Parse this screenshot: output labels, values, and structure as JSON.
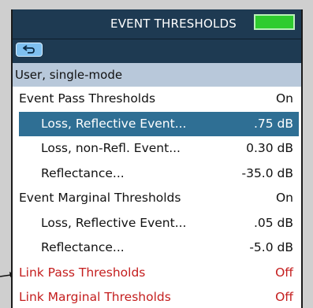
{
  "header": {
    "title": "EVENT THRESHOLDS"
  },
  "toolbar": {
    "back_icon": "back-arrow-icon"
  },
  "section": {
    "label": "User, single-mode"
  },
  "rows": [
    {
      "label": "Event Pass Thresholds",
      "value": "On"
    },
    {
      "label": "Loss, Reflective Event...",
      "value": ".75 dB"
    },
    {
      "label": "Loss, non-Refl. Event...",
      "value": "0.30 dB"
    },
    {
      "label": "Reflectance...",
      "value": "-35.0 dB"
    },
    {
      "label": "Event Marginal Thresholds",
      "value": "On"
    },
    {
      "label": "Loss, Reflective Event...",
      "value": ".05 dB"
    },
    {
      "label": "Reflectance...",
      "value": "-5.0 dB"
    },
    {
      "label": "Link Pass Thresholds",
      "value": "Off"
    },
    {
      "label": "Link Marginal Thresholds",
      "value": "Off"
    }
  ],
  "colors": {
    "titlebar": "#1e3a52",
    "selected_row": "#2f6f94",
    "section_header": "#b8c8da",
    "battery": "#2ecc2e",
    "disabled_text": "#c41e1e"
  }
}
